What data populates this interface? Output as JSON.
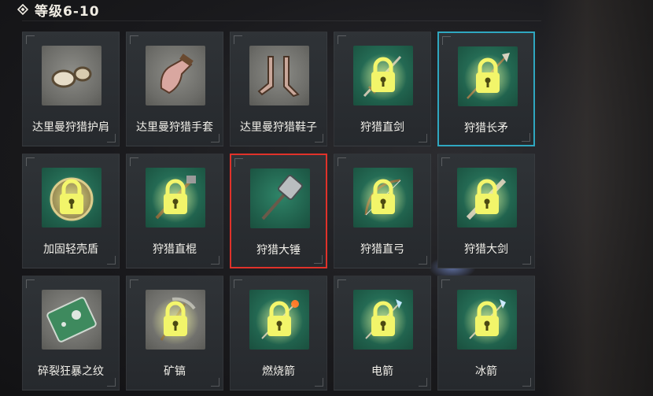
{
  "header": {
    "title": "等级6-10",
    "icon": "diamond-icon"
  },
  "items": [
    {
      "name": "达里曼狩猎护肩",
      "locked": false,
      "icon": "shoulder-pad-icon",
      "bg": "gray"
    },
    {
      "name": "达里曼狩猎手套",
      "locked": false,
      "icon": "glove-icon",
      "bg": "gray"
    },
    {
      "name": "达里曼狩猎鞋子",
      "locked": false,
      "icon": "boots-icon",
      "bg": "gray"
    },
    {
      "name": "狩猎直剑",
      "locked": true,
      "icon": "sword-icon",
      "bg": "green"
    },
    {
      "name": "狩猎长矛",
      "locked": true,
      "icon": "spear-icon",
      "bg": "green",
      "state": "hover"
    },
    {
      "name": "加固轻壳盾",
      "locked": true,
      "icon": "shield-icon",
      "bg": "green"
    },
    {
      "name": "狩猎直棍",
      "locked": true,
      "icon": "staff-icon",
      "bg": "green"
    },
    {
      "name": "狩猎大锤",
      "locked": false,
      "icon": "hammer-icon",
      "bg": "green",
      "state": "selected"
    },
    {
      "name": "狩猎直弓",
      "locked": true,
      "icon": "bow-icon",
      "bg": "green"
    },
    {
      "name": "狩猎大剑",
      "locked": true,
      "icon": "greatsword-icon",
      "bg": "green"
    },
    {
      "name": "碎裂狂暴之纹",
      "locked": false,
      "icon": "circuit-chip-icon",
      "bg": "gray"
    },
    {
      "name": "矿镐",
      "locked": true,
      "icon": "pickaxe-icon",
      "bg": "gray"
    },
    {
      "name": "燃烧箭",
      "locked": true,
      "icon": "fire-arrow-icon",
      "bg": "green"
    },
    {
      "name": "电箭",
      "locked": true,
      "icon": "electric-arrow-icon",
      "bg": "green"
    },
    {
      "name": "冰箭",
      "locked": true,
      "icon": "ice-arrow-icon",
      "bg": "green"
    }
  ],
  "colors": {
    "lock": "#f2f56a",
    "hover_border": "#2fa7c0",
    "selected_border": "#e0322a",
    "green_tile": "#2a7a5f"
  }
}
